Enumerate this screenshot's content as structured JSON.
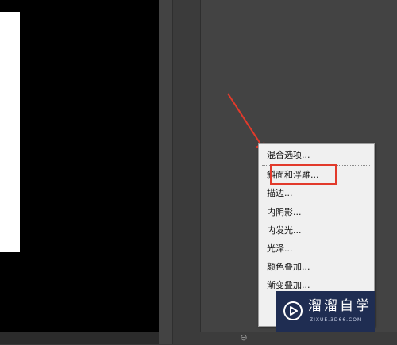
{
  "menu": {
    "items": [
      {
        "label": "混合选项..."
      },
      {
        "label": "斜面和浮雕..."
      },
      {
        "label": "描边..."
      },
      {
        "label": "内阴影..."
      },
      {
        "label": "内发光..."
      },
      {
        "label": "光泽..."
      },
      {
        "label": "颜色叠加..."
      },
      {
        "label": "渐变叠加..."
      }
    ],
    "highlighted_item": "斜面和浮雕..."
  },
  "watermark": {
    "title": "溜溜自学",
    "url": "ZIXUE.3D66.COM"
  },
  "annotation": {
    "arrow_color": "#e23a2b",
    "highlight_color": "#e23a2b"
  },
  "icons": {
    "link": "link-icon",
    "watermark_logo": "play-logo-icon"
  }
}
